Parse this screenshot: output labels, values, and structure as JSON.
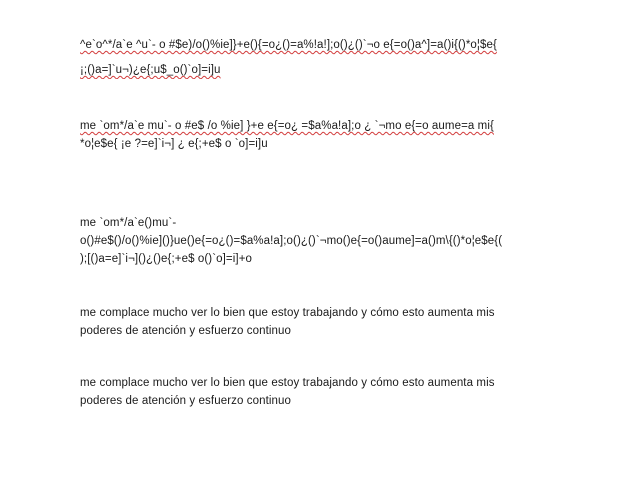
{
  "document": {
    "paragraphs": [
      {
        "lines": [
          "^e`o^*/a`e ^u`- o #$e)/o()%ie]}+e(){=o¿()=a%!a!];o()¿()`¬o e{=o()a^]=a()i{()*o¦$e{",
          "¡;()a=]`u¬)¿e{;u$_o()`o]=i]u"
        ]
      },
      {
        "lines": [
          "me  `om*/a`e mu`- o  #e$  /o  %ie]   }+e   e{=o¿   =$a%a!a];o ¿ `¬mo  e{=o  aume=a  mi{",
          "*o¦e$e{  ¡e  ?=e]`i¬] ¿  e{;+e$    o    `o]=i]u"
        ]
      },
      {
        "lines": [
          "me   `om*/a`e()mu`-",
          "o()#e$()/o()%ie]()}ue()e{=o¿()=$a%a!a];o()¿()`¬mo()e{=o()aume]=a()m\\{()*o¦e$e{(",
          ");[()a=e]`i¬]()¿()e{;+e$    o()`o]=i]+o"
        ]
      },
      {
        "lines": [
          "me  complace    mucho  ver  lo  bien  que estoy trabajando y cómo esto aumenta mis",
          "poderes   de   atención  y   esfuerzo    continuo"
        ]
      },
      {
        "lines": [
          "me complace mucho  ver  lo  bien  que   estoy   trabajando y cómo  esto  aumenta  mis",
          "poderes  de  atención y  esfuerzo   continuo"
        ]
      }
    ],
    "colors": {
      "text": "#1a1a1a",
      "spellcheck_underline": "#d23b3b",
      "grammar_underline": "#3a62c9"
    }
  }
}
